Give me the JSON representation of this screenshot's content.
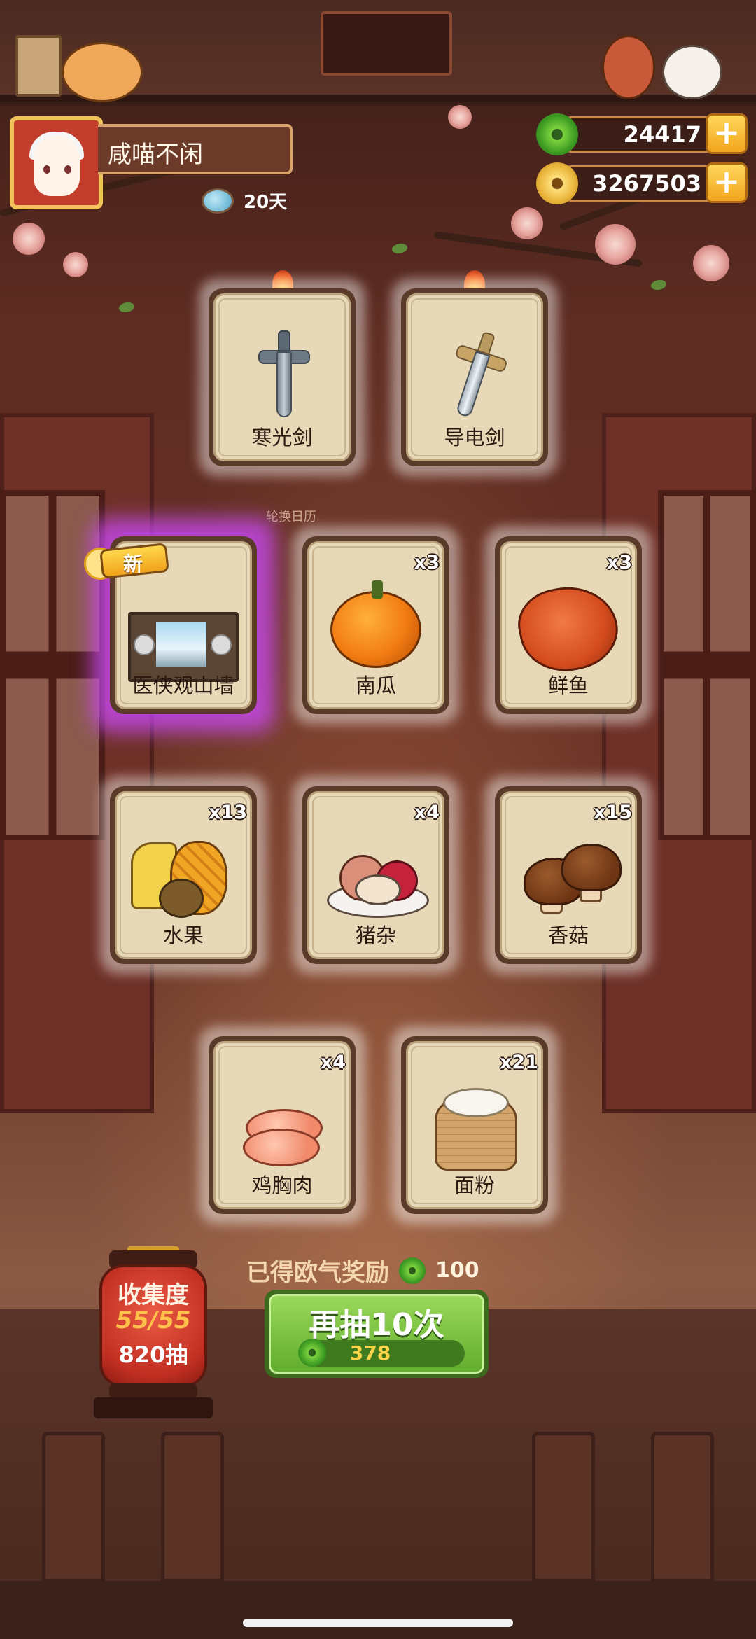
{
  "player": {
    "name": "咸喵不闲",
    "days": "20天"
  },
  "currencies": {
    "jade": "24417",
    "gold": "3267503"
  },
  "scene": {
    "calendar_label": "轮换日历"
  },
  "cards": [
    {
      "name": "寒光剑",
      "qty": "",
      "art": "dark-sword-icon",
      "flame": true
    },
    {
      "name": "导电剑",
      "qty": "",
      "art": "silver-sword-icon",
      "flame": true
    },
    {
      "name": "医侠观山墙",
      "qty": "",
      "art": "wall-decor-icon",
      "new": true
    },
    {
      "name": "南瓜",
      "qty": "x3",
      "art": "pumpkin-icon"
    },
    {
      "name": "鲜鱼",
      "qty": "x3",
      "art": "fish-icon"
    },
    {
      "name": "水果",
      "qty": "x13",
      "art": "fruit-icon"
    },
    {
      "name": "猪杂",
      "qty": "x4",
      "art": "pork-offal-icon"
    },
    {
      "name": "香菇",
      "qty": "x15",
      "art": "mushroom-icon"
    },
    {
      "name": "鸡胸肉",
      "qty": "x4",
      "art": "chicken-breast-icon"
    },
    {
      "name": "面粉",
      "qty": "x21",
      "art": "flour-sack-icon"
    }
  ],
  "new_badge": "新",
  "reward": {
    "text": "已得欧气奖励",
    "amount": "100"
  },
  "draw_button": {
    "label": "再抽10次",
    "cost": "378"
  },
  "collection": {
    "title": "收集度",
    "progress": "55/55",
    "draws": "820抽"
  },
  "colors": {
    "rare_glow": "#ce4aff",
    "button_green": "#62ad2e",
    "gold": "#ffd34a"
  }
}
